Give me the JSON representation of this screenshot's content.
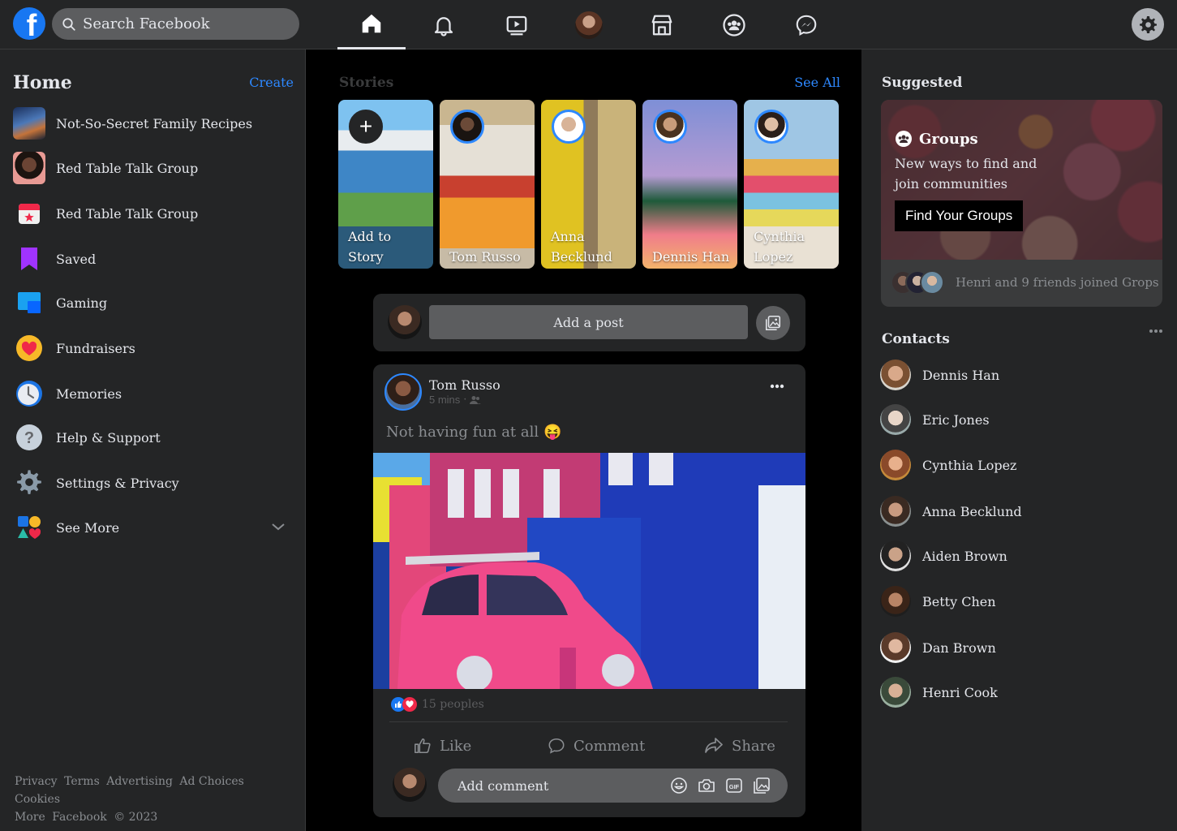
{
  "topbar": {
    "logo_letter": "f",
    "search_placeholder": "Search Facebook",
    "nav_icons": [
      "home-icon",
      "bell-icon",
      "video-icon",
      "profile-avatar",
      "marketplace-icon",
      "groups-icon",
      "messenger-icon"
    ],
    "settings_icon": "gear-icon"
  },
  "left": {
    "title": "Home",
    "create_label": "Create",
    "items": [
      {
        "label": "Not-So-Secret Family Recipes",
        "icon": "group-photo"
      },
      {
        "label": "Red Table Talk Group",
        "icon": "group-photo"
      },
      {
        "label": "Red Table Talk Group",
        "icon": "calendar-star-icon"
      },
      {
        "label": "Saved",
        "icon": "bookmark-icon"
      },
      {
        "label": "Gaming",
        "icon": "gaming-icon"
      },
      {
        "label": "Fundraisers",
        "icon": "heart-icon"
      },
      {
        "label": "Memories",
        "icon": "clock-icon"
      },
      {
        "label": "Help & Support",
        "icon": "question-icon"
      },
      {
        "label": "Settings & Privacy",
        "icon": "gear-icon"
      },
      {
        "label": "See More",
        "icon": "shapes-icon"
      }
    ],
    "footer": [
      "Privacy",
      "Terms",
      "Advertising",
      "Ad Choices",
      "Cookies",
      "More",
      "Facebook",
      "© 2023"
    ]
  },
  "stories": {
    "title": "Stories",
    "see_all": "See All",
    "items": [
      {
        "name": "Add to Story"
      },
      {
        "name": "Tom Russo"
      },
      {
        "name": "Anna Becklund"
      },
      {
        "name": "Dennis Han"
      },
      {
        "name": "Cynthia Lopez"
      }
    ]
  },
  "composer": {
    "add_post": "Add a post"
  },
  "post": {
    "author": "Tom Russo",
    "time": "5 mins",
    "text": "Not having fun at all",
    "emoji": "😝",
    "reactions_count": "15 peoples",
    "actions": {
      "like": "Like",
      "comment": "Comment",
      "share": "Share"
    },
    "comment_placeholder": "Add comment"
  },
  "suggested": {
    "title": "Suggested",
    "card_title": "Groups",
    "card_text": "New ways to find and join communities",
    "card_button": "Find Your Groups",
    "footer_text": "Henri and 9 friends joined Grops"
  },
  "contacts": {
    "title": "Contacts",
    "items": [
      "Dennis Han",
      "Eric Jones",
      "Cynthia Lopez",
      "Anna Becklund",
      "Aiden Brown",
      "Betty Chen",
      "Dan Brown",
      "Henri Cook"
    ]
  },
  "colors": {
    "accent": "#2d88ff",
    "surface": "#242526",
    "background": "#000000"
  }
}
